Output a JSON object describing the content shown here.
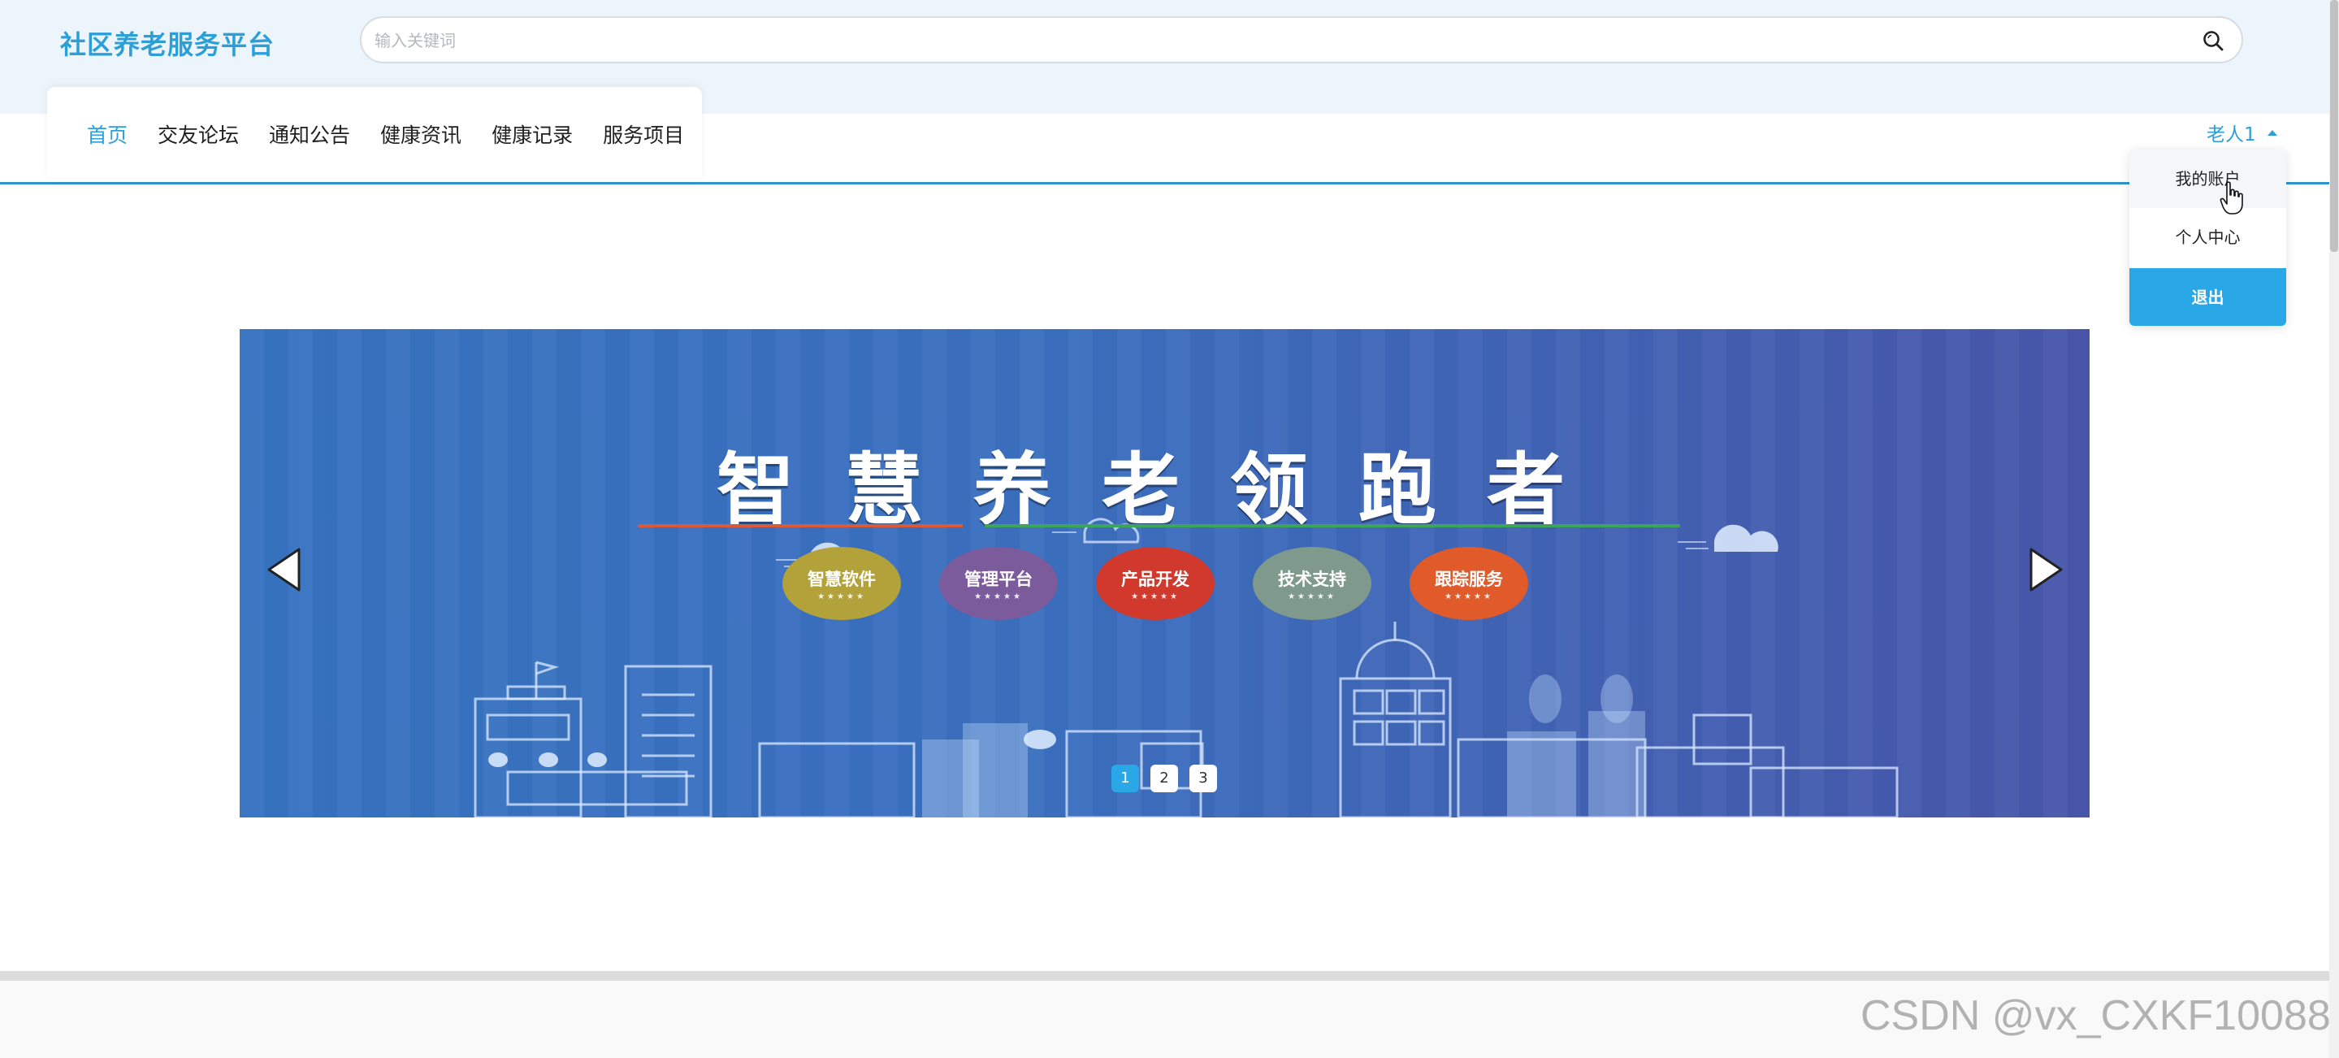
{
  "header": {
    "logo": "社区养老服务平台",
    "search": {
      "placeholder": "输入关键词",
      "value": ""
    }
  },
  "nav": {
    "items": [
      {
        "label": "首页",
        "active": true
      },
      {
        "label": "交友论坛"
      },
      {
        "label": "通知公告"
      },
      {
        "label": "健康资讯"
      },
      {
        "label": "健康记录"
      },
      {
        "label": "服务项目"
      }
    ]
  },
  "user": {
    "name": "老人1",
    "menu": {
      "account": "我的账户",
      "center": "个人中心",
      "logout": "退出"
    }
  },
  "banner": {
    "headline": "智慧养老领跑者",
    "pills": [
      {
        "label": "智慧软件",
        "color": "#b3a23a"
      },
      {
        "label": "管理平台",
        "color": "#7b5b9b"
      },
      {
        "label": "产品开发",
        "color": "#d0392c"
      },
      {
        "label": "技术支持",
        "color": "#7f9a8c"
      },
      {
        "label": "跟踪服务",
        "color": "#e05a2a"
      }
    ],
    "pager": {
      "pages": [
        "1",
        "2",
        "3"
      ],
      "current": "1"
    }
  },
  "watermark": "CSDN @vx_CXKF10088",
  "colors": {
    "accent": "#2d9fd8",
    "header_bg": "#ebf5fb",
    "logout_bg": "#2aa7e6"
  }
}
